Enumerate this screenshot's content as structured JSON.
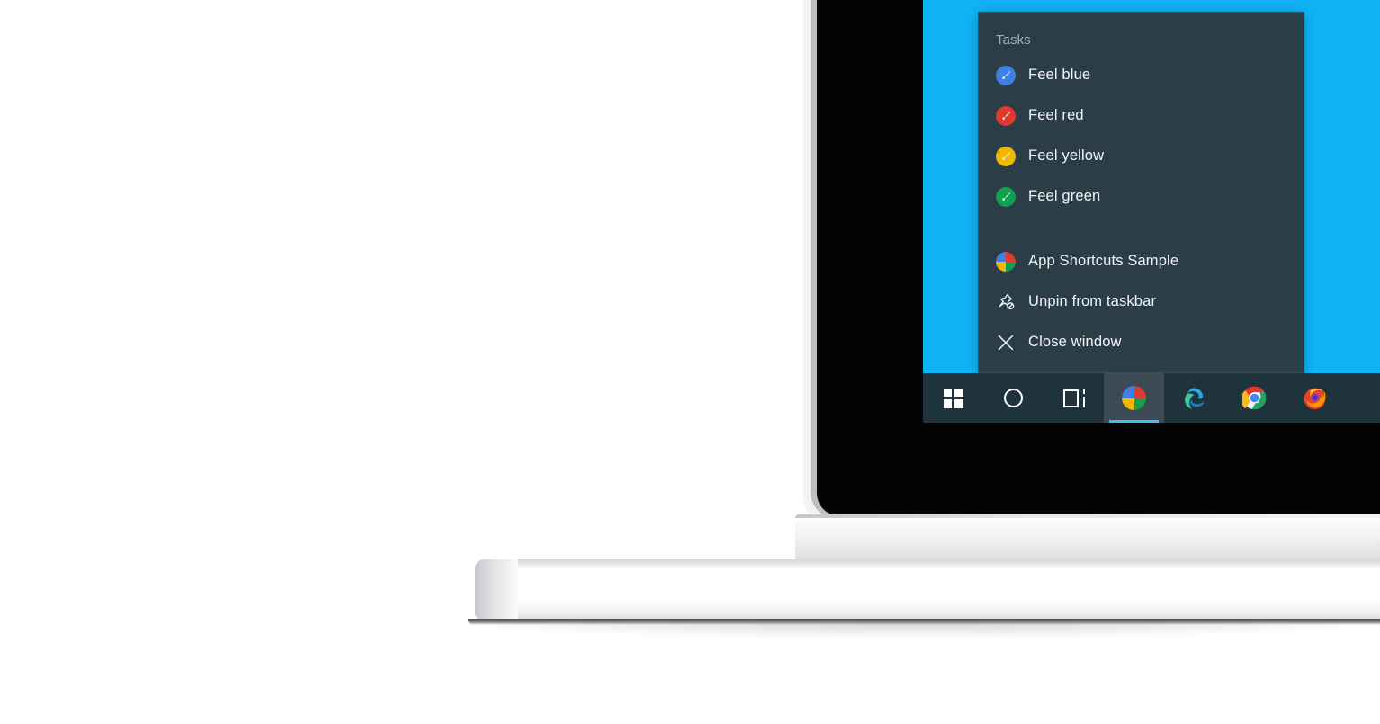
{
  "scene": {
    "description": "Windows 10 laptop showing a taskbar jump list",
    "wallpaper_color": "#11b2f5",
    "panel_color": "#2b3d47",
    "taskbar_color": "#1f333d",
    "accent_color": "#3fbdf4"
  },
  "jumplist": {
    "header": "Tasks",
    "tasks": [
      {
        "label": "Feel blue",
        "icon": "paint-brush-icon",
        "color": "#3f7fe0"
      },
      {
        "label": "Feel red",
        "icon": "paint-brush-icon",
        "color": "#e03a2f"
      },
      {
        "label": "Feel yellow",
        "icon": "paint-brush-icon",
        "color": "#f2b705"
      },
      {
        "label": "Feel green",
        "icon": "paint-brush-icon",
        "color": "#11a050"
      }
    ],
    "actions": [
      {
        "label": "App Shortcuts Sample",
        "icon": "app-pie-icon"
      },
      {
        "label": "Unpin from taskbar",
        "icon": "unpin-icon"
      },
      {
        "label": "Close window",
        "icon": "close-icon"
      }
    ]
  },
  "taskbar": {
    "buttons": [
      {
        "name": "start",
        "icon": "windows-logo-icon",
        "label": "Start",
        "active": false
      },
      {
        "name": "cortana",
        "icon": "cortana-circle-icon",
        "label": "Cortana",
        "active": false
      },
      {
        "name": "task-view",
        "icon": "task-view-icon",
        "label": "Task View",
        "active": false
      },
      {
        "name": "app",
        "icon": "app-pie-icon",
        "label": "App Shortcuts Sample",
        "active": true
      },
      {
        "name": "edge",
        "icon": "microsoft-edge-icon",
        "label": "Microsoft Edge",
        "active": false
      },
      {
        "name": "chrome",
        "icon": "google-chrome-icon",
        "label": "Google Chrome",
        "active": false
      },
      {
        "name": "firefox",
        "icon": "firefox-icon",
        "label": "Mozilla Firefox",
        "active": false
      }
    ]
  },
  "app_icon_colors": {
    "top_left": "#3f7fe0",
    "top_right": "#e03a2f",
    "bottom_left": "#f2b705",
    "bottom_right": "#11a050"
  }
}
